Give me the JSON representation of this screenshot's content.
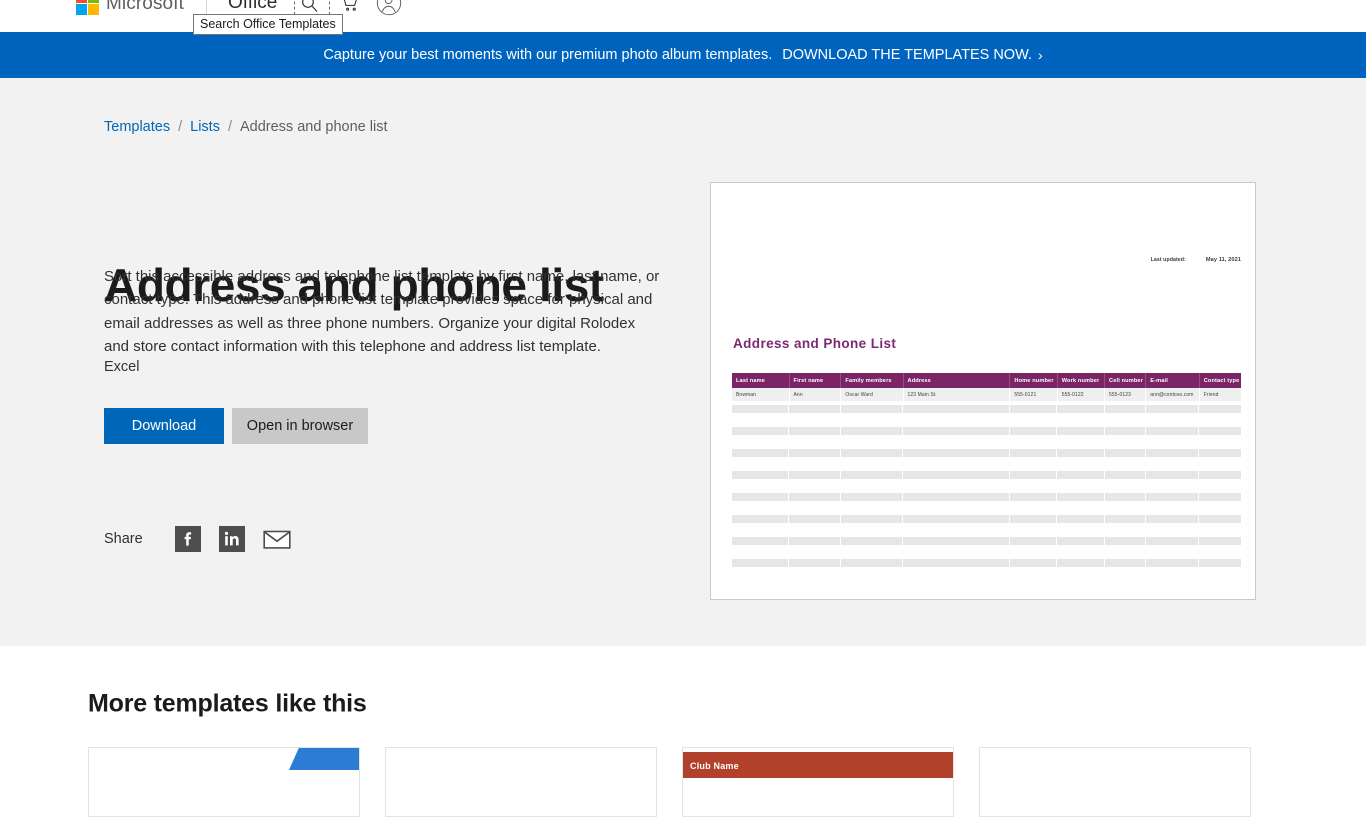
{
  "header": {
    "brand": "Microsoft",
    "product": "Office",
    "icons": [
      {
        "name": "search-icon",
        "glyph": "search"
      },
      {
        "name": "cart-icon",
        "glyph": "cart"
      },
      {
        "name": "account-icon",
        "glyph": "account"
      }
    ],
    "tooltip": "Search Office Templates"
  },
  "promo": {
    "text": "Capture your best moments with our premium photo album templates.",
    "link_text": "DOWNLOAD THE TEMPLATES NOW.",
    "chevron": "›",
    "background": "#0064bf"
  },
  "breadcrumb": {
    "items": [
      {
        "label": "Templates",
        "link": true
      },
      {
        "label": "Lists",
        "link": true
      },
      {
        "label": "Address and phone list",
        "link": false
      }
    ],
    "separator": "/"
  },
  "main": {
    "title": "Address and phone list",
    "description": "Sort this accessible address and telephone list template by first name, last name, or contact type. This address and phone list template provides space for physical and email addresses as well as three phone numbers. Organize your digital Rolodex and store contact information with this telephone and address list template.",
    "app": "Excel",
    "buttons": {
      "download": "Download",
      "open_in_browser": "Open in browser"
    },
    "share": {
      "label": "Share",
      "icons": [
        {
          "name": "facebook-share-icon"
        },
        {
          "name": "linkedin-share-icon"
        },
        {
          "name": "email-share-icon"
        }
      ]
    }
  },
  "preview": {
    "title": "Address and Phone List",
    "last_updated_label": "Last updated:",
    "last_updated_date": "May 11, 2021",
    "accent_color": "#7b2566",
    "columns": [
      "Last name",
      "First name",
      "Family members",
      "Address",
      "Home number",
      "Work number",
      "Cell number",
      "E-mail",
      "Contact type"
    ],
    "rows": [
      [
        "Bowman",
        "Ann",
        "Oscar Ward",
        "123 Main St.",
        "555-0121",
        "555-0122",
        "555-0123",
        "ann@contoso.com",
        "Friend"
      ]
    ],
    "empty_row_count": 8
  },
  "more": {
    "heading": "More templates like this",
    "cards": [
      {
        "name": "template-card-1",
        "style": "corner-blue",
        "label": ""
      },
      {
        "name": "template-card-2",
        "style": "plain",
        "label": ""
      },
      {
        "name": "template-card-3",
        "style": "club-band",
        "label": "Club Name"
      },
      {
        "name": "template-card-4",
        "style": "plain",
        "label": ""
      }
    ]
  }
}
